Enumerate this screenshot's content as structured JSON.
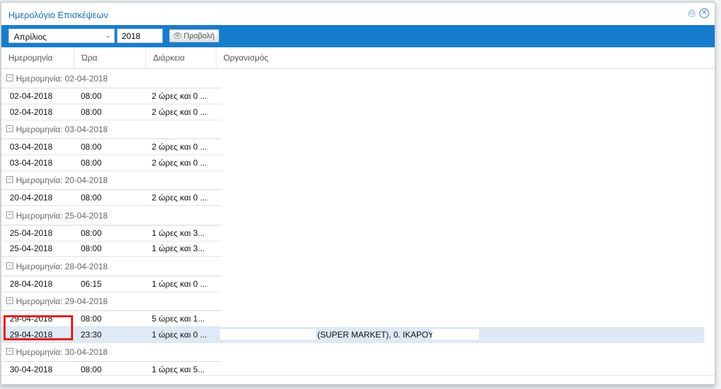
{
  "window": {
    "title": "Ημερολόγιο Επισκέψεων",
    "print_icon": "print-icon",
    "close_icon": "close-icon"
  },
  "toolbar": {
    "month_value": "Απρίλιος",
    "year_value": "2018",
    "view_button_label": "Προβολή"
  },
  "columns": [
    "Ημερομηνία",
    "Ώρα",
    "Διάρκεια",
    "Οργανισμός"
  ],
  "groups": [
    {
      "label": "Ημερομηνία: 02-04-2018",
      "rows": [
        {
          "date": "02-04-2018",
          "time": "08:00",
          "duration": "2 ώρες και 0 ..."
        },
        {
          "date": "02-04-2018",
          "time": "08:00",
          "duration": "2 ώρες και 0 ..."
        }
      ]
    },
    {
      "label": "Ημερομηνία: 03-04-2018",
      "rows": [
        {
          "date": "03-04-2018",
          "time": "08:00",
          "duration": "2 ώρες και 0 ..."
        },
        {
          "date": "03-04-2018",
          "time": "08:00",
          "duration": "2 ώρες και 0 ..."
        }
      ]
    },
    {
      "label": "Ημερομηνία: 20-04-2018",
      "rows": [
        {
          "date": "20-04-2018",
          "time": "08:00",
          "duration": "2 ώρες και 0 ..."
        }
      ]
    },
    {
      "label": "Ημερομηνία: 25-04-2018",
      "rows": [
        {
          "date": "25-04-2018",
          "time": "08:00",
          "duration": "1 ώρες και 3..."
        },
        {
          "date": "25-04-2018",
          "time": "08:00",
          "duration": "1 ώρες και 3..."
        }
      ]
    },
    {
      "label": "Ημερομηνία: 28-04-2018",
      "rows": [
        {
          "date": "28-04-2018",
          "time": "06:15",
          "duration": "1 ώρες και 0 ..."
        }
      ]
    },
    {
      "label": "Ημερομηνία: 29-04-2018",
      "rows": [
        {
          "date": "29-04-2018",
          "time": "08:00",
          "duration": "5 ώρες και 1..."
        },
        {
          "date": "29-04-2018",
          "time": "23:30",
          "duration": "1 ώρες και 0 ...",
          "organization": "(SUPER MARKET), 0. ΙΚΑΡΟΥ",
          "selected": true
        }
      ]
    },
    {
      "label": "Ημερομηνία: 30-04-2018",
      "rows": [
        {
          "date": "30-04-2018",
          "time": "08:00",
          "duration": "1 ώρες και 5..."
        }
      ]
    }
  ]
}
